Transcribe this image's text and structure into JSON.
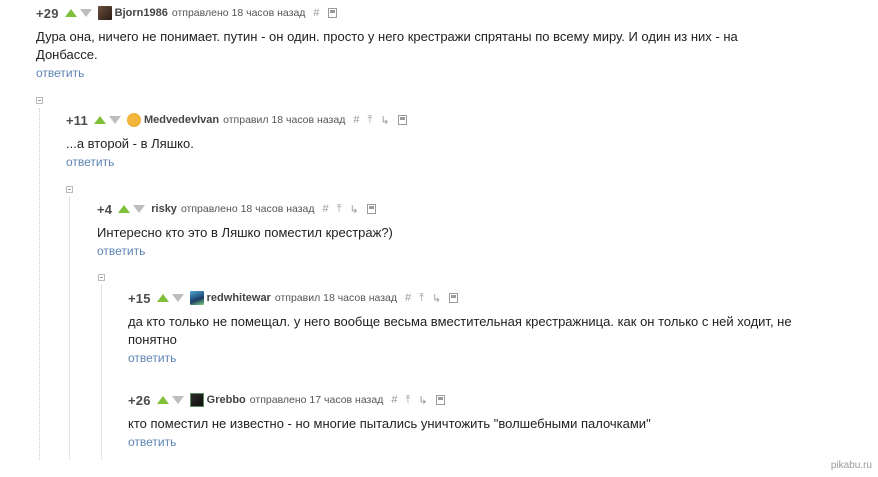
{
  "comments": [
    {
      "rating": "+29",
      "user": "Bjorn1986",
      "meta": "отправлено 18 часов назад",
      "text": "Дура она, ничего не понимает. путин - он один. просто у него крестражи спрятаны по всему миру. И один из них - на Донбассе.",
      "reply": "ответить"
    },
    {
      "rating": "+11",
      "user": "MedvedevIvan",
      "meta": "отправил 18 часов назад",
      "text": "...а второй - в Ляшко.",
      "reply": "ответить"
    },
    {
      "rating": "+4",
      "user": "risky",
      "meta": "отправлено 18 часов назад",
      "text": "Интересно кто это в Ляшко поместил крестраж?)",
      "reply": "ответить"
    },
    {
      "rating": "+15",
      "user": "redwhitewar",
      "meta": "отправил 18 часов назад",
      "text": "да кто только не помещал. у него вообще весьма вместительная крестражница. как он только с ней ходит, не понятно",
      "reply": "ответить"
    },
    {
      "rating": "+26",
      "user": "Grebbo",
      "meta": "отправлено 17 часов назад",
      "text": "кто поместил не известно - но многие пытались уничтожить \"волшебными палочками\"",
      "reply": "ответить"
    }
  ],
  "tools": {
    "hash": "#",
    "up": "⤒",
    "branch": "↳"
  },
  "watermark": "pikabu.ru"
}
